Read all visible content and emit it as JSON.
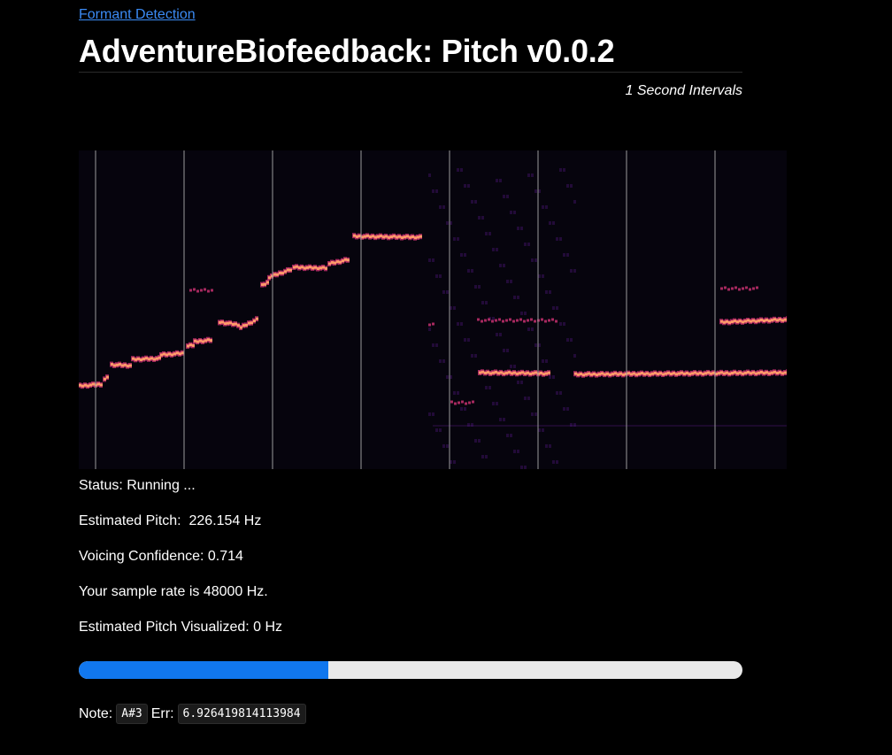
{
  "nav": {
    "link_label": "Formant Detection"
  },
  "header": {
    "title": "AdventureBiofeedback: Pitch v0.0.2",
    "subtitle": "1 Second Intervals"
  },
  "spectrogram": {
    "colors": {
      "background": "#06040d",
      "grid": "#9a9a9a",
      "hot": "#ff9a6a",
      "mid": "#c4306e",
      "cool": "#5a1a8a"
    }
  },
  "status": {
    "status_line": "Status: Running ...",
    "pitch_line": "Estimated Pitch:  226.154 Hz",
    "confidence_line": "Voicing Confidence: 0.714",
    "sample_rate_line": "Your sample rate is 48000 Hz.",
    "visualized_line": "Estimated Pitch Visualized: 0 Hz"
  },
  "progress": {
    "fraction": 0.376,
    "colors": {
      "fill": "#1177ee",
      "track": "#e9e9e9"
    }
  },
  "note": {
    "note_label": "Note:",
    "note_value": "A#3",
    "err_label": "Err:",
    "err_value": "6.926419814113984"
  }
}
